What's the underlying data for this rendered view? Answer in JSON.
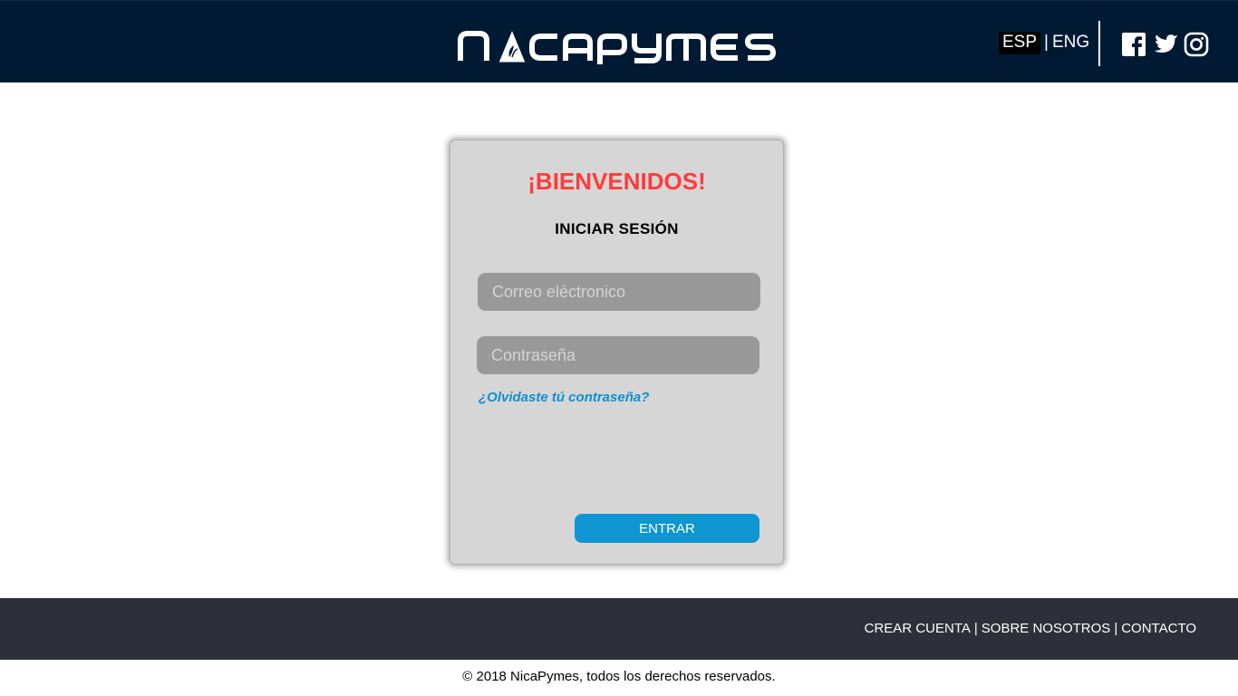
{
  "header": {
    "logo_text": "NicaPymes",
    "lang": {
      "esp": "ESP",
      "separator": "|",
      "eng": "ENG"
    },
    "social": [
      {
        "name": "facebook-icon"
      },
      {
        "name": "twitter-icon"
      },
      {
        "name": "instagram-icon"
      }
    ]
  },
  "login": {
    "welcome": "¡BIENVENIDOS!",
    "subtitle": "INICIAR SESIÓN",
    "email_placeholder": "Correo eléctronico",
    "email_value": "",
    "password_placeholder": "Contraseña",
    "password_value": "",
    "forgot_link": "¿Olvidaste tú contraseña?",
    "submit_label": "ENTRAR"
  },
  "footer": {
    "links": [
      "CREAR CUENTA",
      "SOBRE NOSOTROS",
      "CONTACTO"
    ],
    "separator": "|",
    "copyright": "© 2018 NicaPymes, todos los derechos reservados."
  },
  "colors": {
    "header_bg": "#001a33",
    "welcome": "#ff3b3b",
    "accent": "#0e95d2",
    "footer_bg": "#2d3038",
    "card_bg": "#d6d6d6"
  }
}
